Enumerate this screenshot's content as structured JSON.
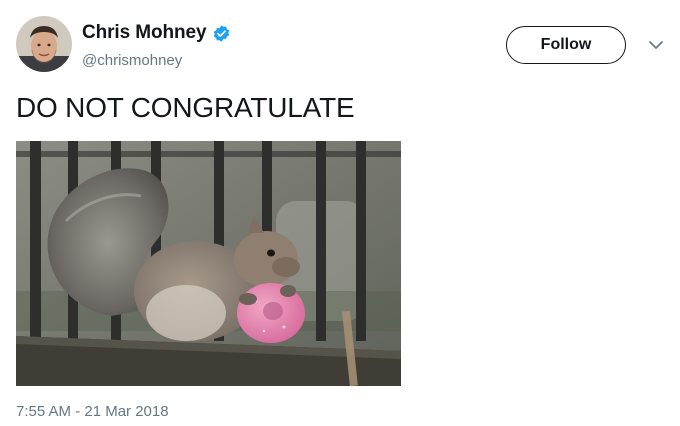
{
  "tweet": {
    "author": {
      "display_name": "Chris Mohney",
      "handle": "@chrismohney",
      "verified_icon": "verified-badge-icon"
    },
    "follow_label": "Follow",
    "menu_icon": "chevron-down-icon",
    "text": "DO NOT CONGRATULATE",
    "media_subject": "squirrel-eating-pink-donut-image",
    "timestamp": "7:55 AM - 21 Mar 2018"
  },
  "colors": {
    "text_primary": "#14171a",
    "text_secondary": "#657786",
    "verified_blue": "#1da1f2"
  }
}
